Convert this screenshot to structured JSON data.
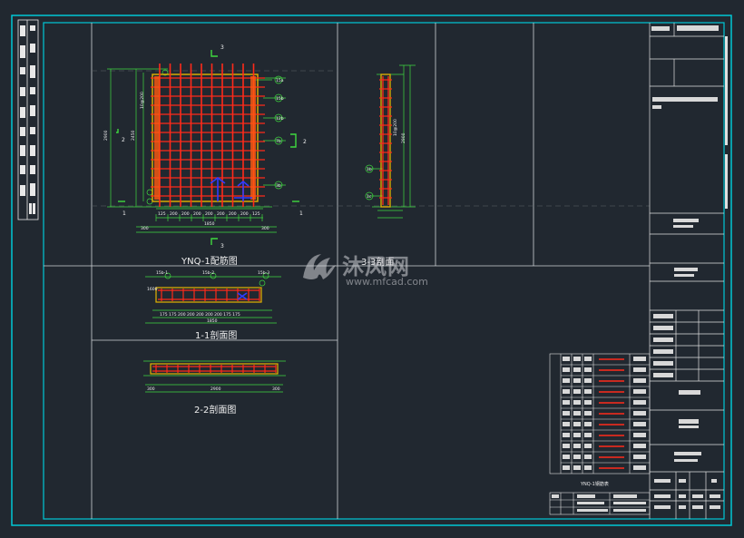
{
  "drawing": {
    "plan_title": "YNQ-1配筋图",
    "section_3_title": "3-3剖面",
    "section_1_title": "1-1剖面图",
    "section_2_title": "2-2剖面图",
    "table_caption": "YNQ-1钢筋表",
    "cut_marks": [
      "1",
      "2",
      "3"
    ]
  },
  "watermark": {
    "brand": "沐风网",
    "url": "www.mfcad.com"
  },
  "colors": {
    "background": "#212830",
    "frame": "#00c8d6",
    "rebar": "#ff2a1a",
    "outline": "#e3b300",
    "dimension": "#3fd93f",
    "anchor": "#2f3cff",
    "text": "#f0f0f0"
  }
}
